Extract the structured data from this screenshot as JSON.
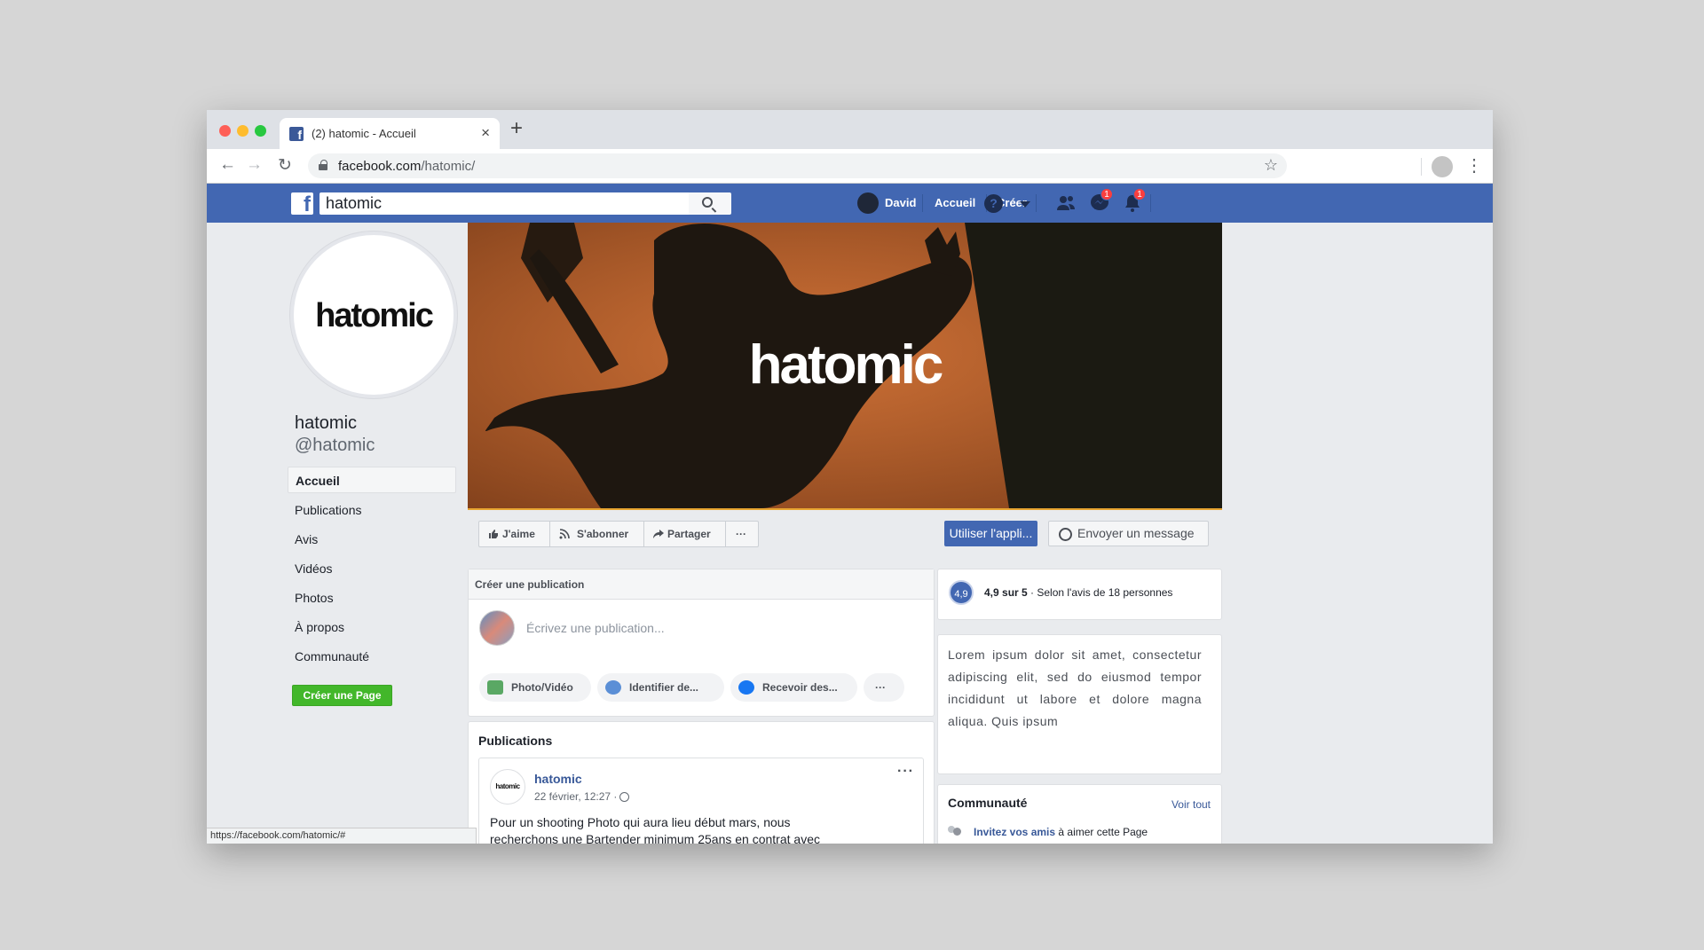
{
  "browser": {
    "tab_title": "(2) hatomic - Accueil",
    "tab_close": "×",
    "new_tab": "+",
    "url_domain": "facebook.com",
    "url_path": "/hatomic/",
    "back": "←",
    "forward": "→",
    "reload": "↻",
    "bookmark": "☆",
    "menu": "⋮",
    "status_url": "https://facebook.com/hatomic/#"
  },
  "fb_header": {
    "search_value": "hatomic",
    "user_name": "David",
    "home_label": "Accueil",
    "create_label": "Créer",
    "messages_badge": "1",
    "notifications_badge": "1",
    "help_label": "?"
  },
  "page": {
    "profile_logo": "hatomic",
    "name": "hatomic",
    "handle": "@hatomic",
    "cover_logo": "hatomic",
    "nav": [
      {
        "label": "Accueil"
      },
      {
        "label": "Publications"
      },
      {
        "label": "Avis"
      },
      {
        "label": "Vidéos"
      },
      {
        "label": "Photos"
      },
      {
        "label": "À propos"
      },
      {
        "label": "Communauté"
      }
    ],
    "create_page": "Créer une Page"
  },
  "actions": {
    "like": "J'aime",
    "follow": "S'abonner",
    "share": "Partager",
    "more": "···",
    "use_app": "Utiliser l'appli...",
    "send_message": "Envoyer un message"
  },
  "composer": {
    "title": "Créer une publication",
    "placeholder": "Écrivez une publication...",
    "photo_video": "Photo/Vidéo",
    "tag": "Identifier de...",
    "receive": "Recevoir des...",
    "more": "···"
  },
  "publications": {
    "title": "Publications",
    "post": {
      "avatar_logo": "hatomic",
      "author": "hatomic",
      "date": "22 février, 12:27 ·",
      "more": "···",
      "text": "Pour un shooting Photo qui aura lieu début mars, nous recherchons une Bartender minimum 25ans en contrat avec un établissement -"
    }
  },
  "rating": {
    "badge": "4,9",
    "score": "4,9 sur 5",
    "detail": " · Selon l'avis de 18 personnes"
  },
  "about": {
    "text": "Lorem ipsum dolor sit amet, consectetur adipiscing elit, sed do eiusmod tempor incididunt ut labore et dolore magna aliqua. Quis ipsum"
  },
  "community": {
    "title": "Communauté",
    "see_all": "Voir tout",
    "invite_link": "Invitez vos amis",
    "invite_rest": " à aimer cette Page"
  },
  "colors": {
    "fb_blue": "#4267b2",
    "cover": "#c2652e",
    "green": "#42b72a"
  }
}
